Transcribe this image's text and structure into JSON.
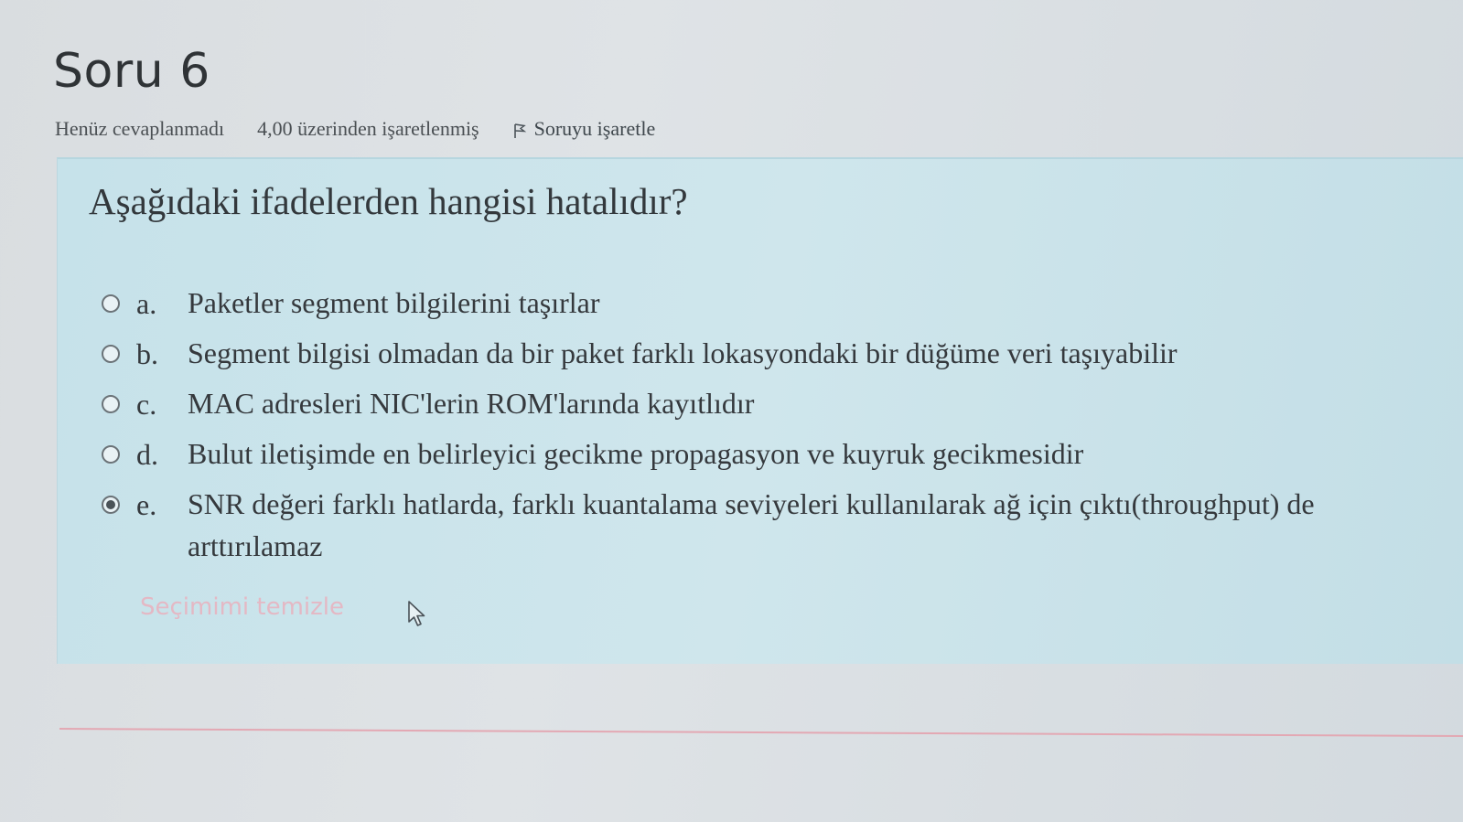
{
  "question": {
    "title": "Soru 6",
    "status": "Henüz cevaplanmadı",
    "grade": "4,00 üzerinden işaretlenmiş",
    "flag_label": "Soruyu işaretle",
    "prompt": "Aşağıdaki ifadelerden hangisi hatalıdır?",
    "answers": [
      {
        "letter": "a.",
        "text": "Paketler segment bilgilerini taşırlar",
        "selected": false
      },
      {
        "letter": "b.",
        "text": "Segment bilgisi olmadan da bir paket farklı lokasyondaki bir düğüme veri taşıyabilir",
        "selected": false
      },
      {
        "letter": "c.",
        "text": "MAC adresleri NIC'lerin ROM'larında kayıtlıdır",
        "selected": false
      },
      {
        "letter": "d.",
        "text": "Bulut iletişimde en belirleyici gecikme propagasyon ve kuyruk gecikmesidir",
        "selected": false
      },
      {
        "letter": "e.",
        "text": "SNR değeri farklı hatlarda, farklı kuantalama seviyeleri kullanılarak ağ için çıktı(throughput) de",
        "text_line2": "arttırılamaz",
        "selected": true
      }
    ],
    "clear_label": "Seçimimi temizle"
  },
  "colors": {
    "panel_bg": "#c9e3ea",
    "divider": "#e3a8b3",
    "clear_link": "#e4b8c4"
  },
  "icons": {
    "flag": "flag-icon",
    "cursor": "mouse-pointer-icon"
  }
}
